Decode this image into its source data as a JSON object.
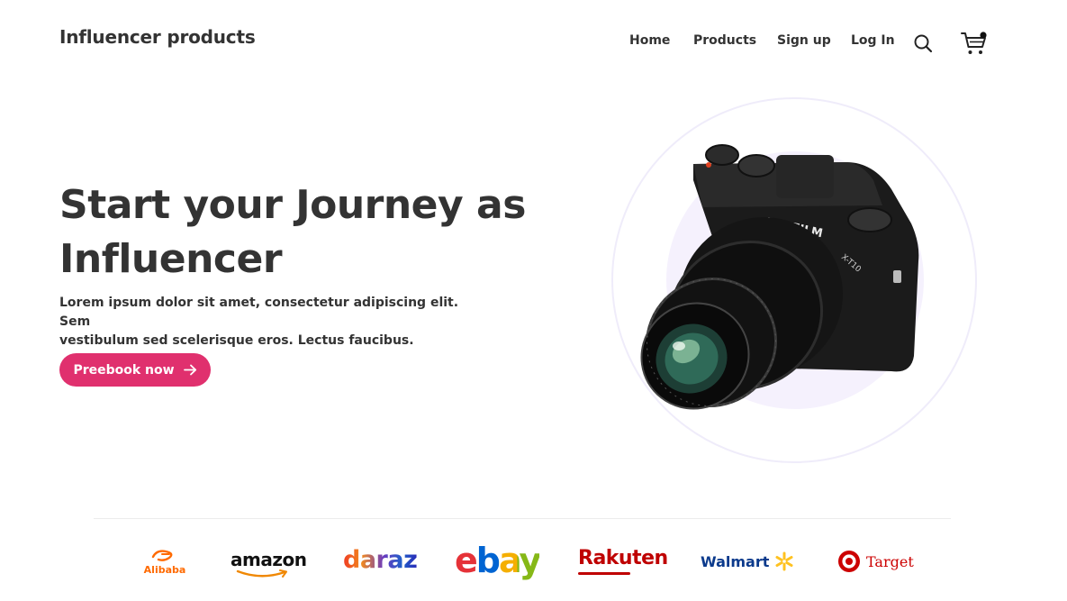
{
  "header": {
    "brand": "Influencer products",
    "nav": [
      {
        "label": "Home"
      },
      {
        "label": "Products"
      },
      {
        "label": "Sign up"
      },
      {
        "label": "Log In"
      }
    ],
    "search_icon": "search-icon",
    "cart_icon": "cart-icon",
    "cart_badge_color": "#111111"
  },
  "hero": {
    "title_line1": "Start your Journey as",
    "title_line2": "Influencer",
    "subtitle_line1": "Lorem ipsum dolor sit amet, consectetur adipiscing elit. Sem",
    "subtitle_line2": "vestibulum sed scelerisque eros. Lectus faucibus.",
    "cta_label": "Preebook now",
    "cta_icon": "arrow-right-icon",
    "cta_color": "#e0306e"
  },
  "product_image": {
    "camera_brand": "FUJIFILM",
    "camera_model": "X-T10"
  },
  "partners": {
    "alibaba": "Alibaba",
    "amazon": "amazon",
    "daraz": "daraz",
    "ebay": "ebay",
    "rakuten": "Rakuten",
    "walmart": "Walmart",
    "target": "Target"
  }
}
